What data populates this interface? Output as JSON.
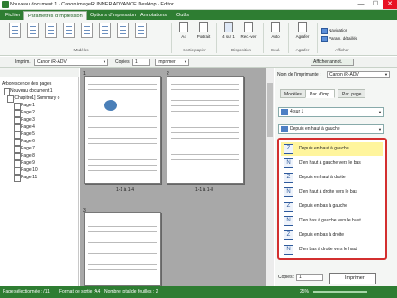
{
  "window": {
    "title": "Nouveau document 1 - Canon imageRUNNER ADVANCE Desktop - Editor",
    "minimize": "—",
    "maximize": "☐",
    "close": "✕"
  },
  "tabs": [
    "Fichier",
    "Paramètres d'impression",
    "Options d'impression",
    "Annotations",
    "Outils"
  ],
  "ribbon": {
    "groups": {
      "modeles": "Modèles",
      "sortie": "Sortie papier",
      "disposition": "Disposition",
      "coul": "Coul.",
      "agrafer": "Agrafer",
      "afficher": "Afficher"
    },
    "buttons": {
      "a4": "A4",
      "portrait": "Portrait",
      "nsur1": "4 sur 1",
      "rectoverso": "Rec.-ver",
      "auto": "Auto",
      "agrafer": "Agrafer"
    },
    "checks": {
      "navigation": "Navigation",
      "params_details": "Param. détaillés"
    }
  },
  "toolbar": {
    "printer_label": "Imprim. :",
    "printer": "Canon iR-ADV",
    "copies_label": "Copies :",
    "copies": "1",
    "print": "Imprimer",
    "show_annot": "Afficher annot."
  },
  "tree": {
    "header": "Arborescence des pages",
    "document": "Nouveau document 1",
    "chapter": "[Chapitre1] Summary o",
    "pages": [
      "Page 1",
      "Page 2",
      "Page 3",
      "Page 4",
      "Page 5",
      "Page 6",
      "Page 7",
      "Page 8",
      "Page 9",
      "Page 10",
      "Page 11"
    ]
  },
  "preview": {
    "page_numbers": [
      "1",
      "2",
      "3"
    ],
    "captions": [
      "1-1 à 1-4",
      "1-1 à 1-8"
    ]
  },
  "panel": {
    "printer_label": "Nom de l'imprimante :",
    "printer": "Canon iR-ADV",
    "tabs": [
      "Modèles",
      "Par. d'imp.",
      "Par. page"
    ],
    "layout_value": "4 sur 1",
    "order_value": "Depuis en haut à gauche",
    "order_options": [
      "Depuis en haut à gauche",
      "D'en haut à gauche vers le bas",
      "Depuis en haut à droite",
      "D'en haut à droite vers le bas",
      "Depuis en bas à gauche",
      "D'en bas à gauche vers le haut",
      "Depuis en bas à droite",
      "D'en bas à droite vers le haut"
    ],
    "copies_label": "Copies :",
    "copies": "1",
    "print_button": "Imprimer"
  },
  "status": {
    "selected": "Page sélectionnée : /11",
    "format": "Format de sortie :A4",
    "total": "Nombre total de feuilles : 2",
    "zoom": "25%"
  },
  "colors": {
    "accent": "#2e7d32",
    "highlight": "#d32f2f",
    "selection": "#fff59d"
  }
}
